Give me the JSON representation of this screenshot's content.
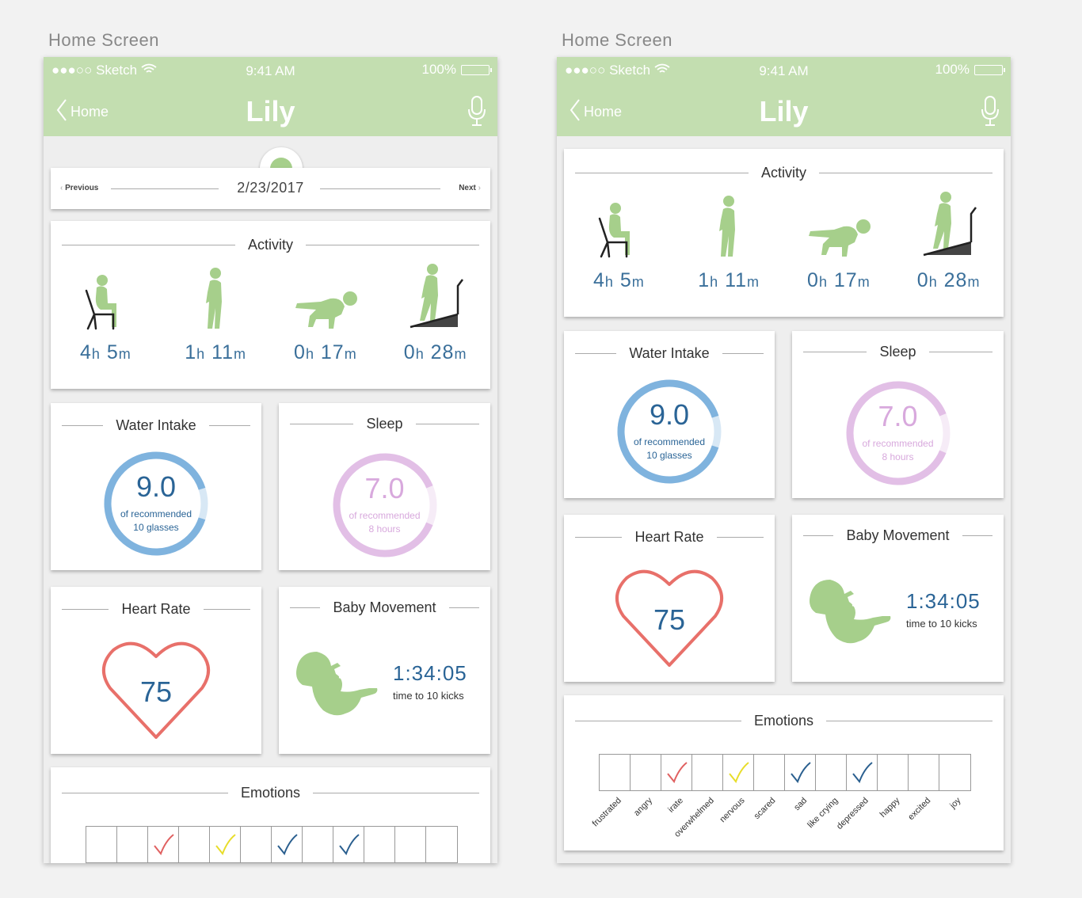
{
  "screens": [
    {
      "label": "Home Screen",
      "status": {
        "carrier": "●●●○○ Sketch",
        "time": "9:41 AM",
        "battery": "100%"
      },
      "nav": {
        "back": "Home",
        "title": "Lily"
      },
      "date_bar": {
        "prev": "Previous",
        "date": "2/23/2017",
        "next": "Next"
      }
    },
    {
      "label": "Home Screen",
      "status": {
        "carrier": "●●●○○ Sketch",
        "time": "9:41 AM",
        "battery": "100%"
      }
    }
  ],
  "activity": {
    "title": "Activity",
    "items": [
      {
        "icon": "sitting-icon",
        "h": "4",
        "m": "5"
      },
      {
        "icon": "walking-icon",
        "h": "1",
        "m": "11"
      },
      {
        "icon": "yoga-icon",
        "h": "0",
        "m": "17"
      },
      {
        "icon": "treadmill-icon",
        "h": "0",
        "m": "28"
      }
    ],
    "h_unit": "h",
    "m_unit": "m"
  },
  "water": {
    "title": "Water Intake",
    "value": "9.0",
    "line1": "of recommended",
    "line2": "10 glasses",
    "fraction": 0.9
  },
  "sleep": {
    "title": "Sleep",
    "value": "7.0",
    "line1": "of recommended",
    "line2": "8 hours",
    "fraction": 0.875
  },
  "heart": {
    "title": "Heart Rate",
    "value": "75"
  },
  "baby": {
    "title": "Baby Movement",
    "time": "1:34:05",
    "sub": "time to 10 kicks"
  },
  "emotions": {
    "title": "Emotions",
    "items": [
      {
        "label": "frustrated",
        "check": ""
      },
      {
        "label": "angry",
        "check": ""
      },
      {
        "label": "irate",
        "check": "#e06060"
      },
      {
        "label": "overwhelmed",
        "check": ""
      },
      {
        "label": "nervous",
        "check": "#e8dd2a"
      },
      {
        "label": "scared",
        "check": ""
      },
      {
        "label": "sad",
        "check": "#2a5f8f"
      },
      {
        "label": "like crying",
        "check": ""
      },
      {
        "label": "depressed",
        "check": "#2a5f8f"
      },
      {
        "label": "happy",
        "check": ""
      },
      {
        "label": "excited",
        "check": ""
      },
      {
        "label": "joy",
        "check": ""
      }
    ]
  },
  "colors": {
    "green": "#c3deb0",
    "figure": "#a6cf8b",
    "blue": "#2a6496",
    "ring_blue": "#7fb3de",
    "ring_pink": "#e2bfe6",
    "heart": "#e8706a"
  }
}
